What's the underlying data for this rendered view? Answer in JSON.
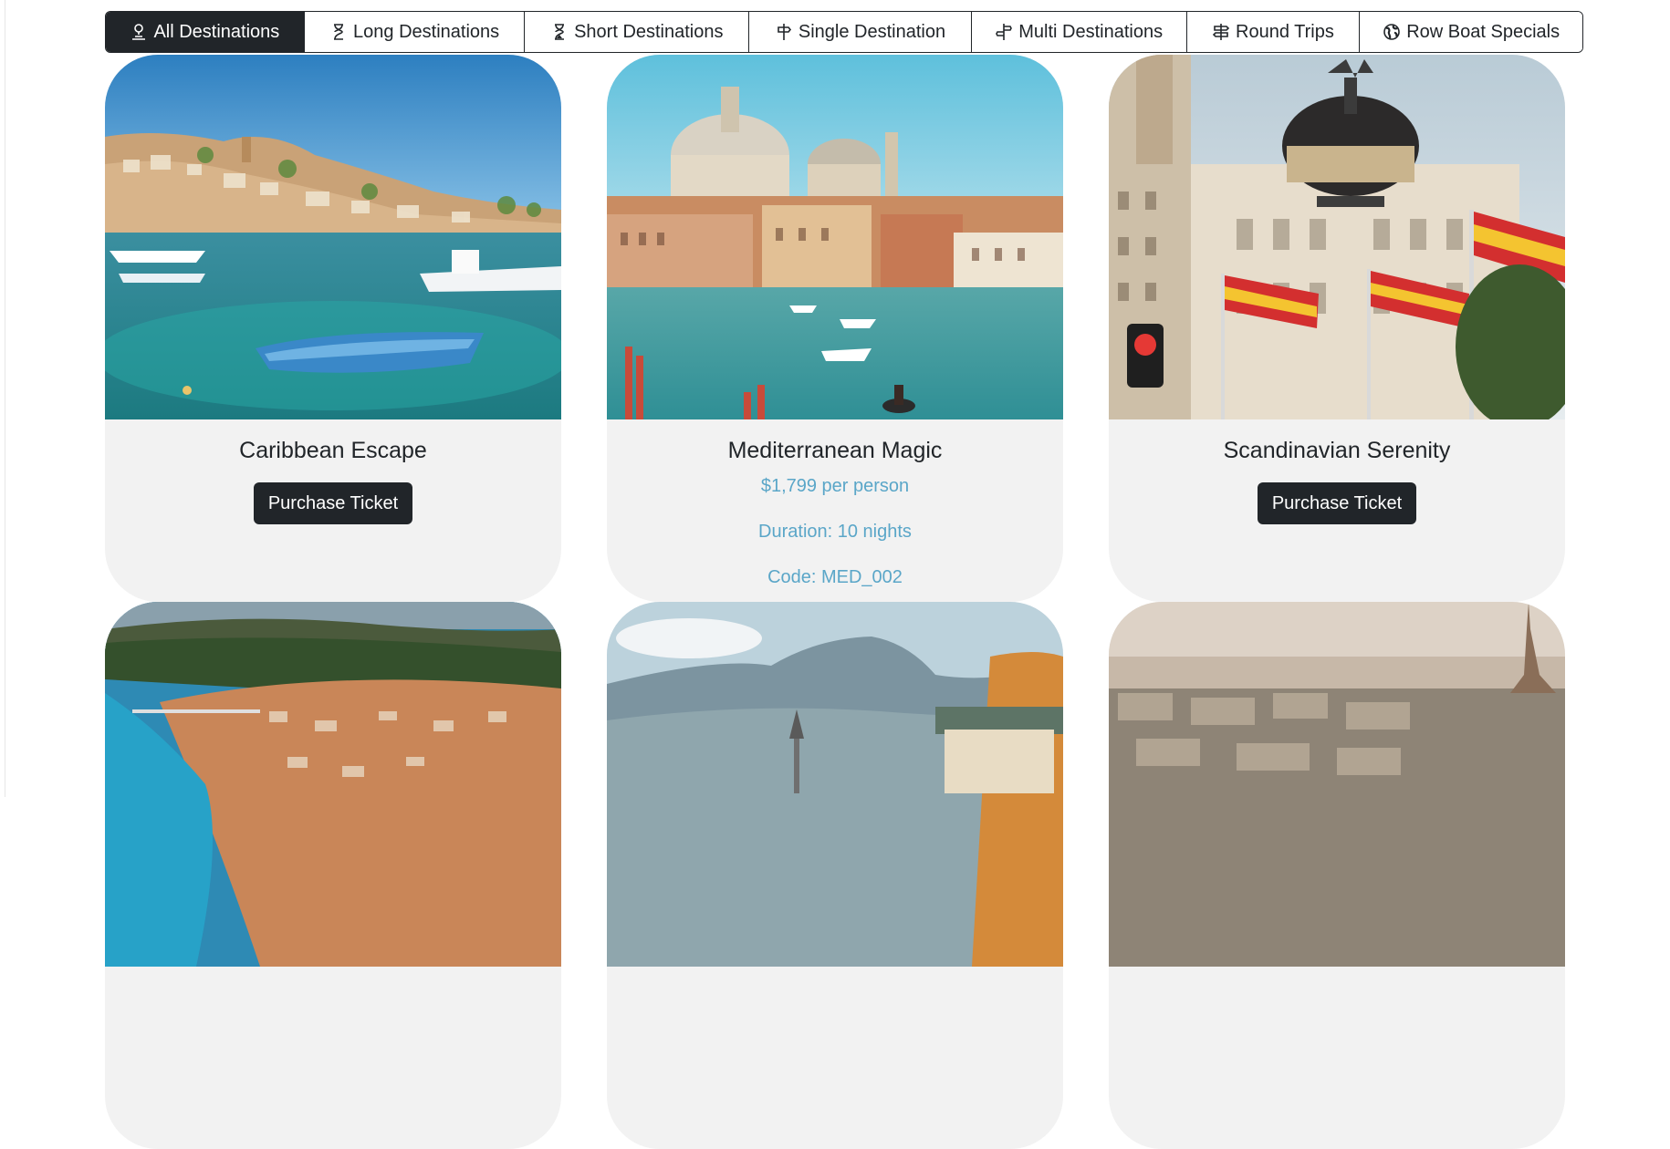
{
  "tabs": [
    {
      "label": "All Destinations",
      "icon": "person-pin-icon",
      "active": true
    },
    {
      "label": "Long Destinations",
      "icon": "hourglass-icon",
      "active": false
    },
    {
      "label": "Short Destinations",
      "icon": "hourglass-bottom-icon",
      "active": false
    },
    {
      "label": "Single Destination",
      "icon": "signpost-icon",
      "active": false
    },
    {
      "label": "Multi Destinations",
      "icon": "signpost-split-icon",
      "active": false
    },
    {
      "label": "Round Trips",
      "icon": "signpost-2-icon",
      "active": false
    },
    {
      "label": "Row Boat Specials",
      "icon": "globe-icon",
      "active": false
    }
  ],
  "cards": [
    {
      "title": "Caribbean Escape",
      "button": "Purchase Ticket",
      "image": "harbor-town-photo"
    },
    {
      "title": "Mediterranean Magic",
      "price": "$1,799 per person",
      "duration": "Duration: 10 nights",
      "code": "Code: MED_002",
      "image": "venice-canal-photo"
    },
    {
      "title": "Scandinavian Serenity",
      "button": "Purchase Ticket",
      "image": "metropolis-building-photo"
    },
    {
      "image": "coastal-town-aerial-photo"
    },
    {
      "image": "alpine-village-photo"
    },
    {
      "image": "paris-skyline-photo"
    }
  ],
  "colors": {
    "dark": "#212529",
    "card_bg": "#f2f2f2",
    "info_text": "#5aa6c8"
  }
}
